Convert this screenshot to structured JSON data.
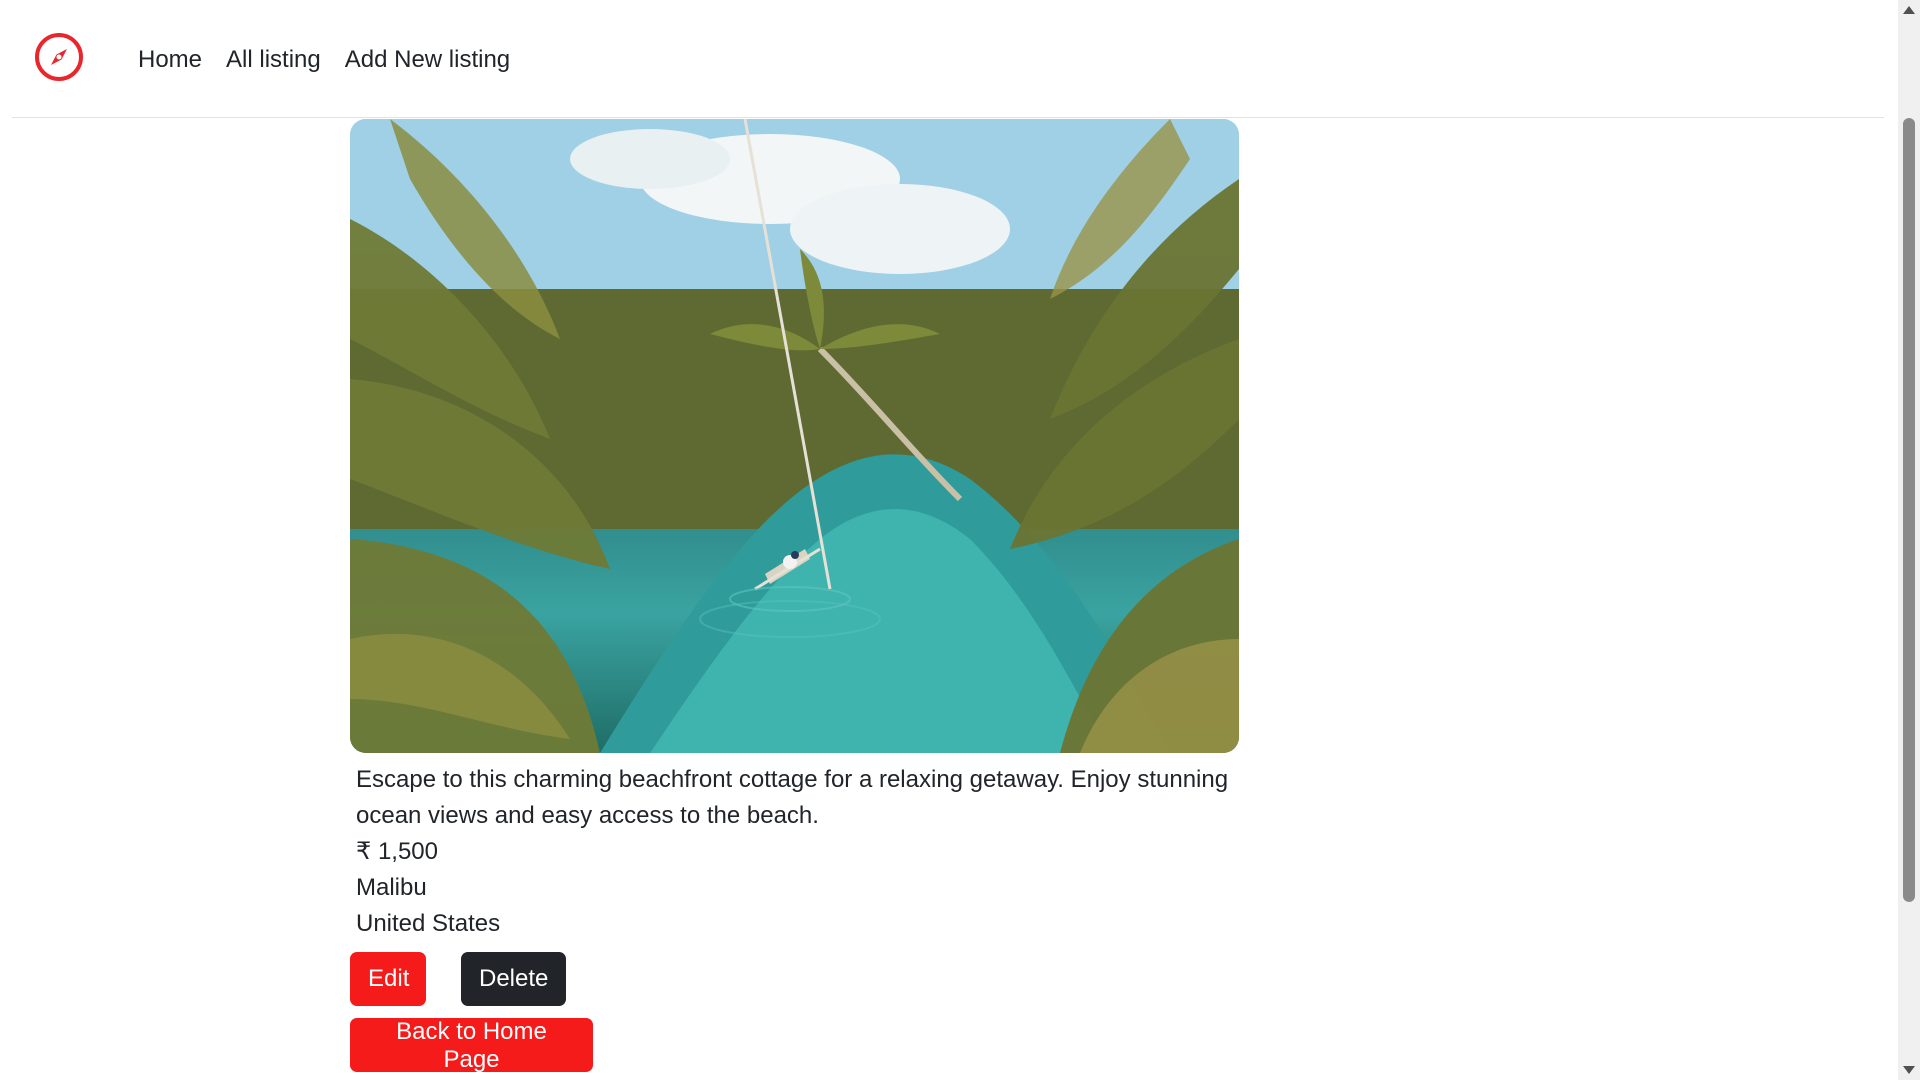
{
  "nav": {
    "logo_icon": "compass-icon",
    "brand_color": "#e8262b",
    "links": [
      {
        "label": "Home"
      },
      {
        "label": "All listing"
      },
      {
        "label": "Add New listing"
      }
    ]
  },
  "listing": {
    "image_alt": "Palm-lined river with a small boat",
    "description": "Escape to this charming beachfront cottage for a relaxing getaway. Enjoy stunning ocean views and easy access to the beach.",
    "price": "₹ 1,500",
    "location": "Malibu",
    "country": "United States"
  },
  "actions": {
    "edit_label": "Edit",
    "delete_label": "Delete",
    "back_label": "Back to Home Page"
  }
}
